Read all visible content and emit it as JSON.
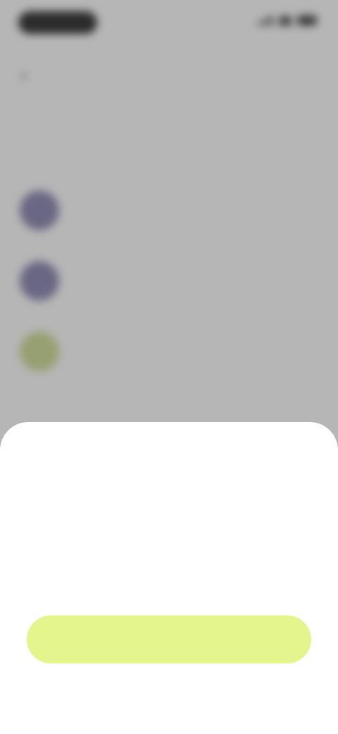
{
  "status_bar": {
    "time": ""
  },
  "background_screen": {
    "title": "",
    "options": [
      {
        "title": "",
        "description": "",
        "color": "#7b78a8"
      },
      {
        "title": "",
        "description": "",
        "color": "#7b78a8"
      },
      {
        "title": "",
        "description": "",
        "color": "#c9d987"
      }
    ]
  },
  "sheet": {
    "title": "",
    "subtitle": "",
    "button_label": "",
    "link_text": ""
  },
  "colors": {
    "accent": "#e3f58c",
    "overlay": "rgba(80,80,80,0.42)"
  }
}
